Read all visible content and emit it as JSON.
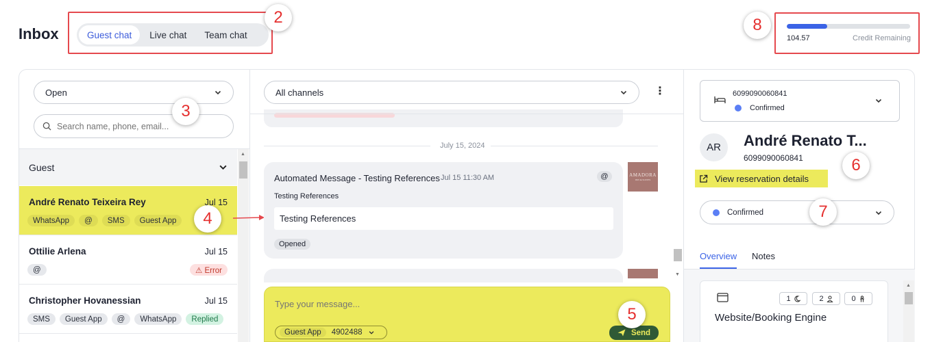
{
  "header": {
    "title": "Inbox",
    "tabs": [
      {
        "label": "Guest chat",
        "active": true
      },
      {
        "label": "Live chat",
        "active": false
      },
      {
        "label": "Team chat",
        "active": false
      }
    ],
    "credit": {
      "amount": "104.57",
      "label": "Credit Remaining",
      "fill_fraction": 0.33
    }
  },
  "annotations": {
    "a2": "2",
    "a3": "3",
    "a4": "4",
    "a5": "5",
    "a6": "6",
    "a7": "7",
    "a8": "8"
  },
  "left": {
    "filter_value": "Open",
    "search_placeholder": "Search name, phone, email...",
    "section_title": "Guest",
    "conversations": [
      {
        "name": "André Renato Teixeira Rey",
        "date": "Jul 15",
        "chips": [
          "WhatsApp",
          "@",
          "SMS",
          "Guest App"
        ]
      },
      {
        "name": "Ottilie Arlena",
        "date": "Jul 15",
        "chips": [
          "@"
        ],
        "status": "⚠ Error"
      },
      {
        "name": "Christopher Hovanessian",
        "date": "Jul 15",
        "chips": [
          "SMS",
          "Guest App",
          "@",
          "WhatsApp",
          "Replied"
        ]
      }
    ]
  },
  "middle": {
    "channel_filter": "All channels",
    "date_divider": "July 15, 2024",
    "message": {
      "title": "Automated Message - Testing References",
      "time": "Jul 15 11:30 AM",
      "channel_tag": "@",
      "subject": "Testing References",
      "body": "Testing References",
      "status": "Opened"
    },
    "brand": {
      "name": "AMADORA",
      "tagline": "INN & SUITES"
    },
    "composer": {
      "placeholder": "Type your message...",
      "channel": "Guest App",
      "channel_id": "4902488",
      "send_label": "Send"
    }
  },
  "right": {
    "reservation": {
      "number": "6099090060841",
      "status": "Confirmed"
    },
    "guest": {
      "initials": "AR",
      "name": "André Renato T...",
      "phone": "6099090060841"
    },
    "view_details_label": "View reservation details",
    "status_select": "Confirmed",
    "tabs": [
      {
        "label": "Overview",
        "active": true
      },
      {
        "label": "Notes",
        "active": false
      }
    ],
    "source": {
      "title": "Website/Booking Engine",
      "nights": "1",
      "guests": "2",
      "children": "0"
    }
  },
  "colors": {
    "accent": "#3b63e6",
    "highlight": "#ecea5c",
    "annotation": "#e5484d",
    "send": "#2f5a36"
  }
}
